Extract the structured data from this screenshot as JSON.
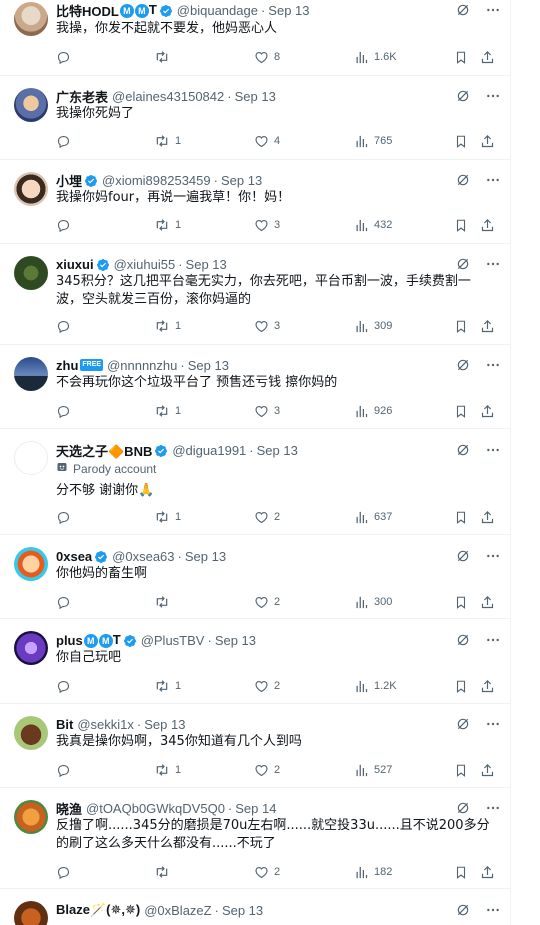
{
  "colors": {
    "accent": "#1d9bf0",
    "muted": "#536471",
    "text": "#0f1419"
  },
  "tweets": [
    {
      "name": "比特HODL",
      "badges": "Ⓜ Ⓜ T",
      "verified": true,
      "handle": "@biquandage",
      "time": "Sep 13",
      "text": "我操，你发不起就不要发，他妈恶心人",
      "replies": "",
      "retweets": "",
      "likes": "8",
      "views": "1.6K"
    },
    {
      "name": "广东老表",
      "verified": false,
      "handle": "@elaines43150842",
      "time": "Sep 13",
      "text": "我操你死妈了",
      "replies": "",
      "retweets": "1",
      "likes": "4",
      "views": "765"
    },
    {
      "name": "小埋",
      "verified": true,
      "handle": "@xiomi898253459",
      "time": "Sep 13",
      "text": "我操你妈four，再说一遍我草！你！妈！",
      "replies": "",
      "retweets": "1",
      "likes": "3",
      "views": "432"
    },
    {
      "name": "xiuxui",
      "verified": true,
      "handle": "@xiuhui55",
      "time": "Sep 13",
      "text": "345积分？这几把平台毫无实力，你去死吧，平台币割一波，手续费割一波，空头就发三百份，滚你妈逼的",
      "replies": "",
      "retweets": "1",
      "likes": "3",
      "views": "309"
    },
    {
      "name": "zhu",
      "badge_free": "FREE",
      "verified": false,
      "handle": "@nnnnnzhu",
      "time": "Sep 13",
      "text": "不会再玩你这个垃圾平台了 预售还亏钱 擦你妈的",
      "replies": "",
      "retweets": "1",
      "likes": "3",
      "views": "926"
    },
    {
      "name": "天选之子🔶BNB",
      "verified": true,
      "handle": "@digua1991",
      "time": "Sep 13",
      "parody": "Parody account",
      "text": "分不够 谢谢你🙏",
      "replies": "",
      "retweets": "1",
      "likes": "2",
      "views": "637"
    },
    {
      "name": "0xsea",
      "verified": true,
      "handle": "@0xsea63",
      "time": "Sep 13",
      "text": "你他妈的畜生啊",
      "replies": "",
      "retweets": "",
      "likes": "2",
      "views": "300"
    },
    {
      "name": "plus",
      "badges": "Ⓜ Ⓜ T",
      "verified": true,
      "handle": "@PlusTBV",
      "time": "Sep 13",
      "text": "你自己玩吧",
      "replies": "",
      "retweets": "1",
      "likes": "2",
      "views": "1.2K"
    },
    {
      "name": "Bit",
      "verified": false,
      "handle": "@sekki1x",
      "time": "Sep 13",
      "text": "我真是操你妈啊，345你知道有几个人到吗",
      "replies": "",
      "retweets": "1",
      "likes": "2",
      "views": "527"
    },
    {
      "name": "晓渔",
      "verified": false,
      "handle": "@tOAQb0GWkqDV5Q0",
      "time": "Sep 14",
      "text": "反撸了啊......345分的磨损是70u左右啊......就空投33u......且不说200多分的刷了这么多天什么都没有......不玩了",
      "replies": "",
      "retweets": "",
      "likes": "2",
      "views": "182"
    },
    {
      "name": "Blaze🪄(✵,✵)",
      "verified": false,
      "handle": "@0xBlazeZ",
      "time": "Sep 13",
      "text": "",
      "replies": "",
      "retweets": "",
      "likes": "",
      "views": ""
    }
  ]
}
